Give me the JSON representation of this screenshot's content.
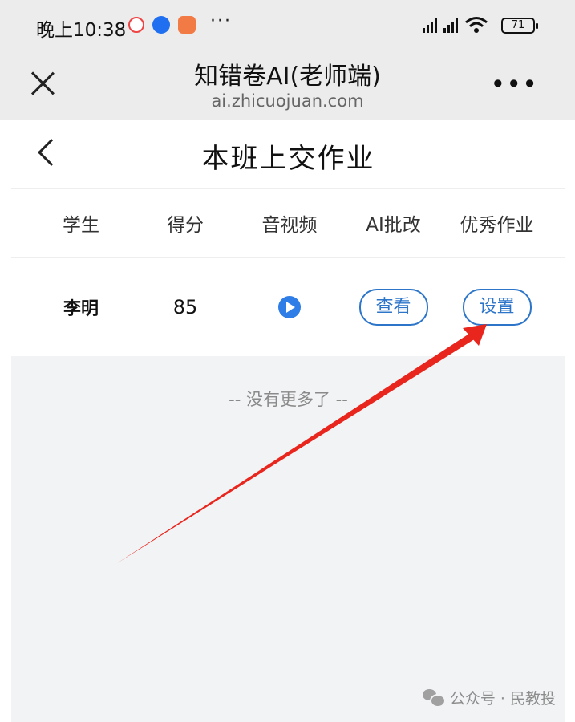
{
  "status_bar": {
    "time": "晚上10:38",
    "more": "···",
    "battery": "71"
  },
  "browser": {
    "title": "知错卷AI(老师端)",
    "url": "ai.zhicuojuan.com",
    "more": "•••"
  },
  "page": {
    "title": "本班上交作业",
    "columns": [
      "学生",
      "得分",
      "音视频",
      "AI批改",
      "优秀作业"
    ],
    "rows": [
      {
        "student": "李明",
        "score": "85",
        "ai_button": "查看",
        "best_button": "设置"
      }
    ],
    "no_more": "-- 没有更多了 --"
  },
  "watermark": "公众号 · 民教投",
  "colors": {
    "accent_blue": "#2c75c9",
    "play_blue": "#2f7de6",
    "annotation_red": "#e8261e"
  }
}
